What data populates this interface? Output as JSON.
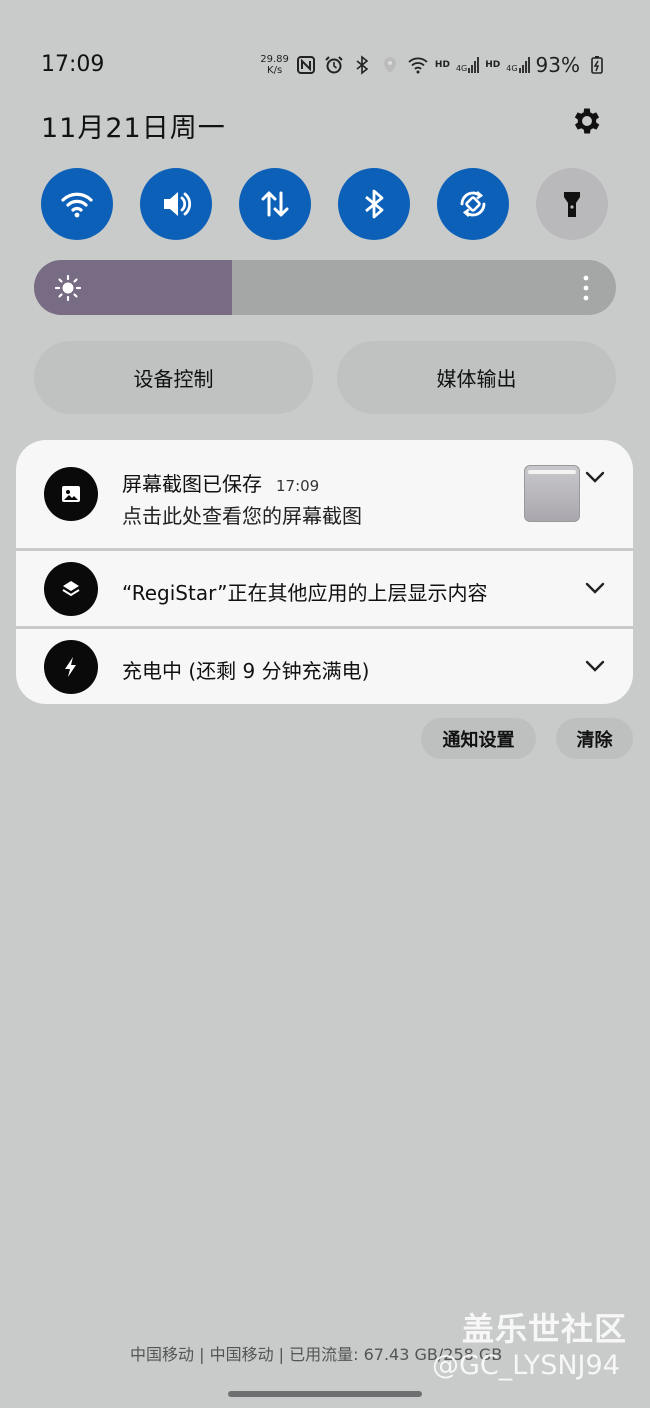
{
  "status_bar": {
    "time": "17:09",
    "net_speed_value": "29.89",
    "net_speed_unit": "K/s",
    "hd1": "HD",
    "sig1_label": "4G",
    "hd2": "HD",
    "sig2_label": "4G",
    "battery": "93%",
    "icons": [
      "nfc-icon",
      "alarm-icon",
      "bluetooth-icon",
      "location-icon",
      "wifi-icon",
      "signal-icon",
      "battery-charging-icon"
    ]
  },
  "header": {
    "date": "11月21日周一",
    "settings_icon": "gear-icon"
  },
  "quick_tiles": [
    {
      "name": "wifi",
      "icon": "wifi-icon",
      "active": true
    },
    {
      "name": "sound",
      "icon": "speaker-icon",
      "active": true
    },
    {
      "name": "mobile-data",
      "icon": "data-arrows-icon",
      "active": true
    },
    {
      "name": "bluetooth",
      "icon": "bluetooth-icon",
      "active": true
    },
    {
      "name": "auto-rotate",
      "icon": "rotate-icon",
      "active": true
    },
    {
      "name": "flashlight",
      "icon": "flashlight-icon",
      "active": false
    }
  ],
  "brightness": {
    "level": 0.34
  },
  "controls": {
    "device_control": "设备控制",
    "media_output": "媒体输出"
  },
  "notifications": [
    {
      "icon": "image-icon",
      "title": "屏幕截图已保存",
      "time": "17:09",
      "subtitle": "点击此处查看您的屏幕截图"
    },
    {
      "icon": "layers-icon",
      "title": "“RegiStar”正在其他应用的上层显示内容"
    },
    {
      "icon": "bolt-icon",
      "title": "充电中 (还剩 9 分钟充满电)"
    }
  ],
  "actions": {
    "notification_settings": "通知设置",
    "clear": "清除"
  },
  "footer": {
    "carrier_info": "中国移动 | 中国移动 | 已用流量: 67.43 GB/258 GB"
  },
  "watermark": {
    "line1": "盖乐世社区",
    "line2": "@GC_LYSNJ94"
  },
  "colors": {
    "background": "#c8cbca",
    "tile_active": "#0d60b8",
    "tile_inactive": "#b9b9bc",
    "brightness_fill": "#786c85",
    "card": "#f7f7f7"
  }
}
